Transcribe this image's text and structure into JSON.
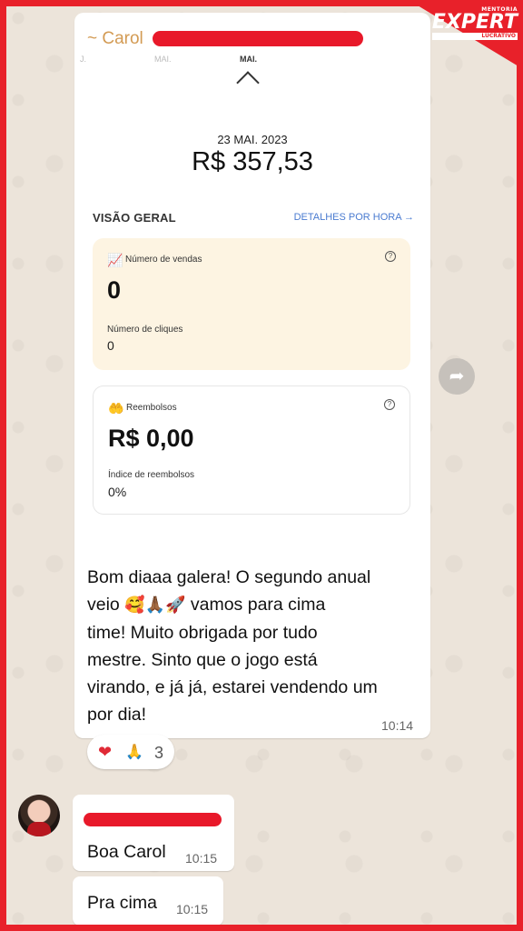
{
  "chat": {
    "sender_name": "~ Carol",
    "forward_icon": "share-arrow"
  },
  "screenshot": {
    "months": [
      "J.",
      "MAI.",
      "MAI."
    ],
    "date": "23 MAI. 2023",
    "amount": "R$ 357,53",
    "overview_label": "VISÃO GERAL",
    "details_link": "DETALHES POR HORA →",
    "sales_card": {
      "label": "Número de vendas",
      "value": "0",
      "sub_label": "Número de cliques",
      "sub_value": "0"
    },
    "refund_card": {
      "label": "Reembolsos",
      "value": "R$ 0,00",
      "sub_label": "Índice de reembolsos",
      "sub_value": "0%"
    }
  },
  "message": {
    "line1": "Bom diaaa galera! O segundo anual",
    "line2_before": "veio ",
    "line2_emojis": "🥰🙏🏾🚀",
    "line2_after": " vamos para cima",
    "line3": "time! Muito obrigada por tudo",
    "line4": "mestre. Sinto que o jogo está",
    "line5": "virando, e já já, estarei vendendo um",
    "line6": "por dia!",
    "time": "10:14"
  },
  "reactions": {
    "heart": "❤",
    "pray": "🙏",
    "count": "3"
  },
  "replies": [
    {
      "text": "Boa Carol",
      "time": "10:15"
    },
    {
      "text": "Pra cima",
      "time": "10:15"
    }
  ],
  "logo": {
    "top": "MENTORIA",
    "main": "EXPERT",
    "sub": "LUCRATIVO"
  },
  "colors": {
    "frame": "#e8212a",
    "sender": "#d39b54",
    "link": "#4a7bd0",
    "redaction": "#e8192a"
  }
}
